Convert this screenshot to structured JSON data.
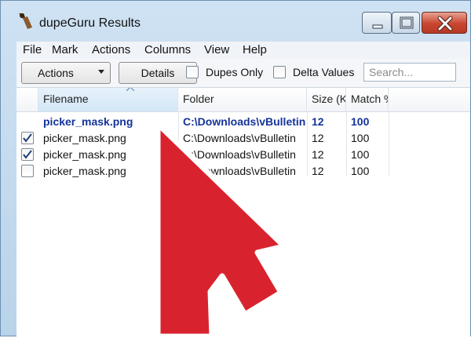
{
  "window": {
    "title": "dupeGuru Results"
  },
  "menu": [
    "File",
    "Mark",
    "Actions",
    "Columns",
    "View",
    "Help"
  ],
  "toolbar": {
    "actions_label": "Actions",
    "details_label": "Details",
    "dupes_only_label": "Dupes Only",
    "delta_values_label": "Delta Values",
    "search_placeholder": "Search..."
  },
  "table": {
    "columns": [
      "Filename",
      "Folder",
      "Size (KB)",
      "Match %"
    ],
    "rows": [
      {
        "group": true,
        "checked": null,
        "filename": "picker_mask.png",
        "folder": "C:\\Downloads\\vBulletin",
        "size": "12",
        "match": "100"
      },
      {
        "group": false,
        "checked": true,
        "filename": "picker_mask.png",
        "folder": "C:\\Downloads\\vBulletin",
        "size": "12",
        "match": "100"
      },
      {
        "group": false,
        "checked": true,
        "filename": "picker_mask.png",
        "folder": "C:\\Downloads\\vBulletin",
        "size": "12",
        "match": "100"
      },
      {
        "group": false,
        "checked": false,
        "filename": "picker_mask.png",
        "folder": "C:\\Downloads\\vBulletin",
        "size": "12",
        "match": "100"
      }
    ]
  },
  "overlay": {
    "arrow_color": "#d8232f",
    "arrow_outline": "#ffffff"
  }
}
